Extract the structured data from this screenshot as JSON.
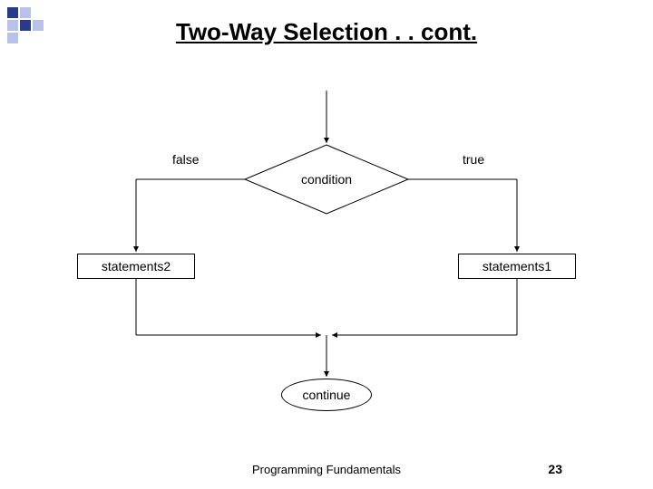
{
  "title": "Two-Way Selection . . cont.",
  "labels": {
    "false": "false",
    "true": "true",
    "condition": "condition",
    "statements2": "statements2",
    "statements1": "statements1",
    "continue": "continue"
  },
  "footer": "Programming Fundamentals",
  "page": "23",
  "colors": {
    "accent1": "#2a3a8a",
    "accent2": "#b8c2e8"
  }
}
